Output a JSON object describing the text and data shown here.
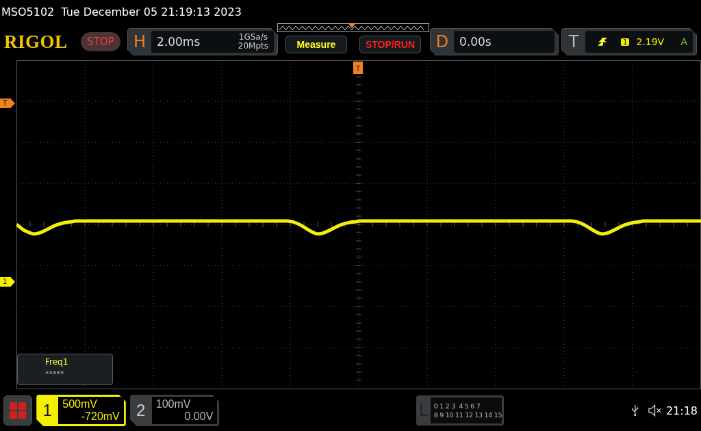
{
  "title_bar": {
    "model": "MSO5102",
    "datetime": "Tue December 05 21:19:13 2023"
  },
  "header": {
    "logo": "RIGOL",
    "run_state": {
      "label": "STOP",
      "running": false
    },
    "horizontal": {
      "letter": "H",
      "timebase": "2.00ms",
      "sample_rate": "1GSa/s",
      "memory_depth": "20Mpts"
    },
    "buttons": [
      {
        "label": "Measure",
        "kind": "measure"
      },
      {
        "label": "STOP/RUN",
        "kind": "stoprun"
      }
    ],
    "delay": {
      "letter": "D",
      "value": "0.00s"
    },
    "trigger": {
      "letter": "T",
      "source": "1",
      "level": "2.19V",
      "mode": "A"
    }
  },
  "screen": {
    "time_marker": "T",
    "markers": [
      {
        "label": "T",
        "kind": "trigger"
      },
      {
        "label": "1",
        "kind": "channel"
      }
    ],
    "measurement": {
      "name": "Freq1",
      "value": "*****"
    }
  },
  "bottom": {
    "channels": [
      {
        "number": "1",
        "scale": "500mV",
        "offset": "-720mV",
        "selected": true
      },
      {
        "number": "2",
        "scale": "100mV",
        "offset": "0.00V",
        "selected": false
      }
    ],
    "logic": {
      "letter": "L",
      "row_1": "0 1 2 3  4 5 6 7",
      "row_2": "8 9 10 11 12 13 14 15"
    },
    "clock": "21:18"
  }
}
